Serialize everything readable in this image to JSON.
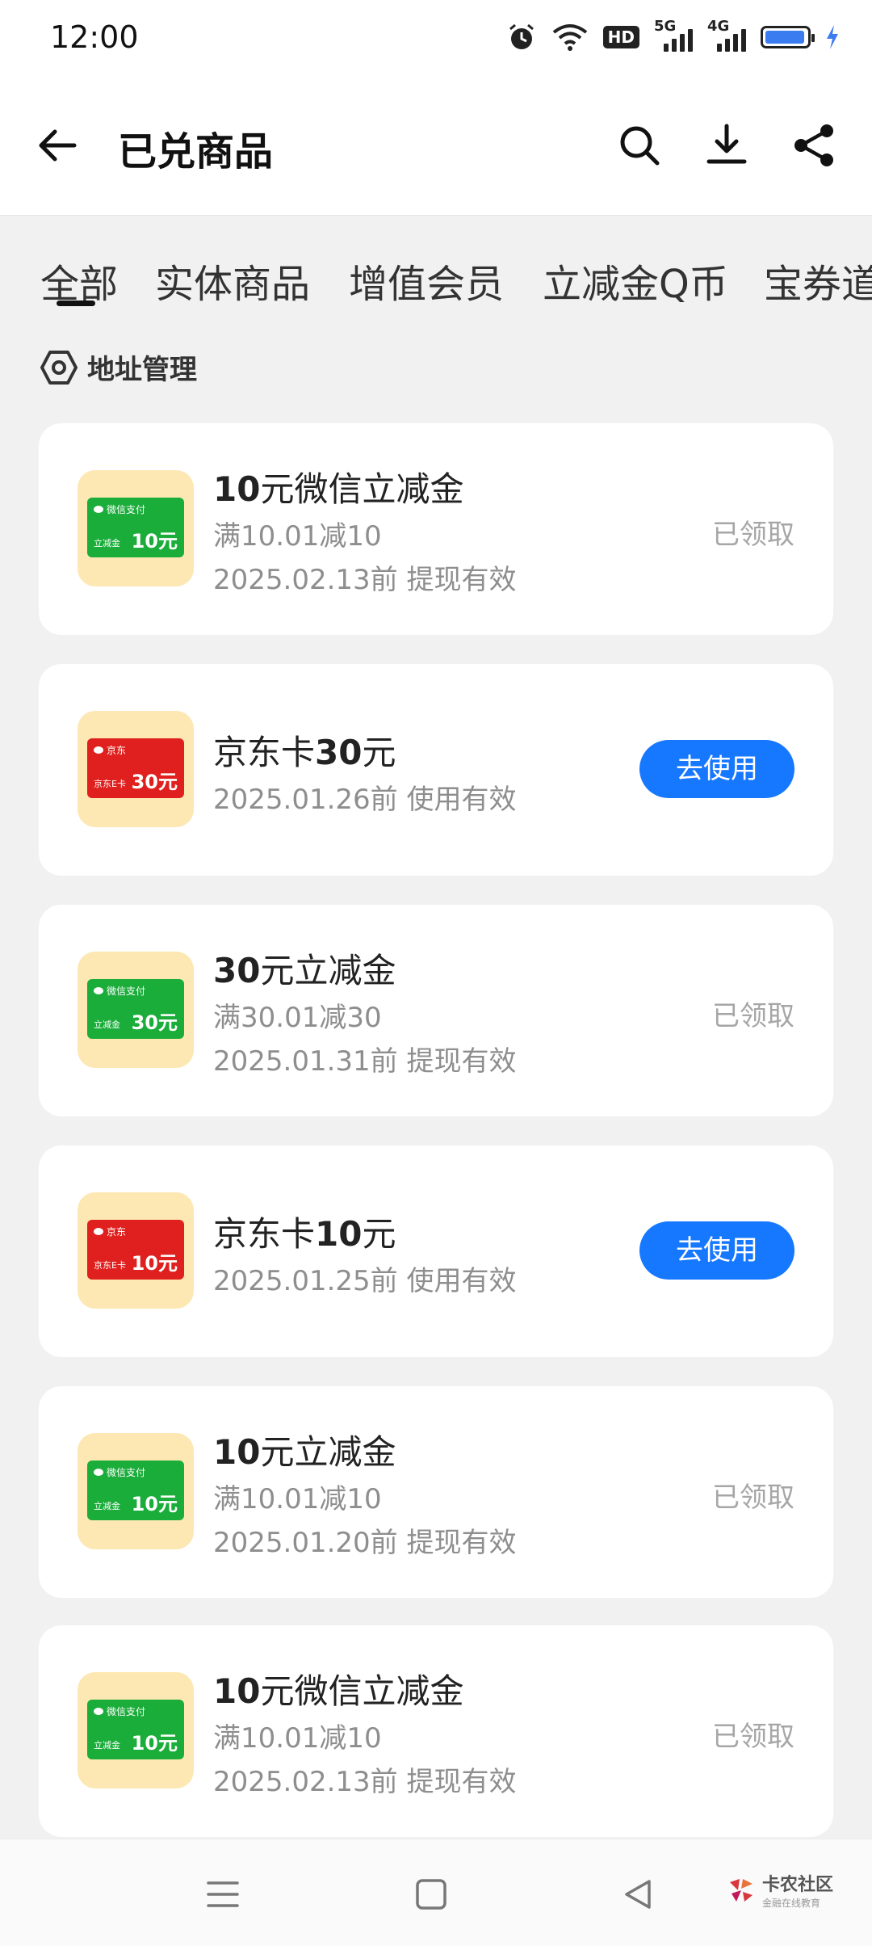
{
  "status_bar": {
    "time": "12:00",
    "network_1": "5G",
    "network_2": "4G",
    "hd_badge": "HD"
  },
  "header": {
    "title": "已兑商品"
  },
  "tabs": [
    {
      "label": "全部",
      "selected": true
    },
    {
      "label": "实体商品"
    },
    {
      "label": "增值会员"
    },
    {
      "label": "立减金Q币"
    },
    {
      "label": "宝券道"
    }
  ],
  "address": {
    "label": "地址管理"
  },
  "items": [
    {
      "title_bold": "10",
      "title_rest": "元微信立减金",
      "line1": "满10.01减10",
      "line2": "2025.02.13前 提现有效",
      "status": "已领取",
      "thumb": {
        "brand": "微信支付",
        "sub": "立减金",
        "amount": "10元"
      }
    },
    {
      "title_plain": "京东卡",
      "title_bold": "30",
      "title_rest": "元",
      "line1": "2025.01.26前 使用有效",
      "action": "去使用",
      "thumb": {
        "brand": "京东",
        "sub": "京东E卡",
        "amount": "30元"
      }
    },
    {
      "title_bold": "30",
      "title_rest": "元立减金",
      "line1": "满30.01减30",
      "line2": "2025.01.31前 提现有效",
      "status": "已领取",
      "thumb": {
        "brand": "微信支付",
        "sub": "立减金",
        "amount": "30元"
      }
    },
    {
      "title_plain": "京东卡",
      "title_bold": "10",
      "title_rest": "元",
      "line1": "2025.01.25前 使用有效",
      "action": "去使用",
      "thumb": {
        "brand": "京东",
        "sub": "京东E卡",
        "amount": "10元"
      }
    },
    {
      "title_bold": "10",
      "title_rest": "元立减金",
      "line1": "满10.01减10",
      "line2": "2025.01.20前 提现有效",
      "status": "已领取",
      "thumb": {
        "brand": "微信支付",
        "sub": "立减金",
        "amount": "10元"
      }
    },
    {
      "title_bold": "10",
      "title_rest": "元微信立减金",
      "line1": "满10.01减10",
      "line2": "2025.02.13前 提现有效",
      "status": "已领取",
      "thumb": {
        "brand": "微信支付",
        "sub": "立减金",
        "amount": "10元"
      }
    }
  ],
  "watermark": {
    "name": "卡农社区",
    "sub": "金融在线教育"
  },
  "colors": {
    "accent": "#1677ff",
    "thumb_bg": "#fde8b4",
    "wechat_green": "#1aad3a",
    "jd_red": "#e0201f"
  }
}
